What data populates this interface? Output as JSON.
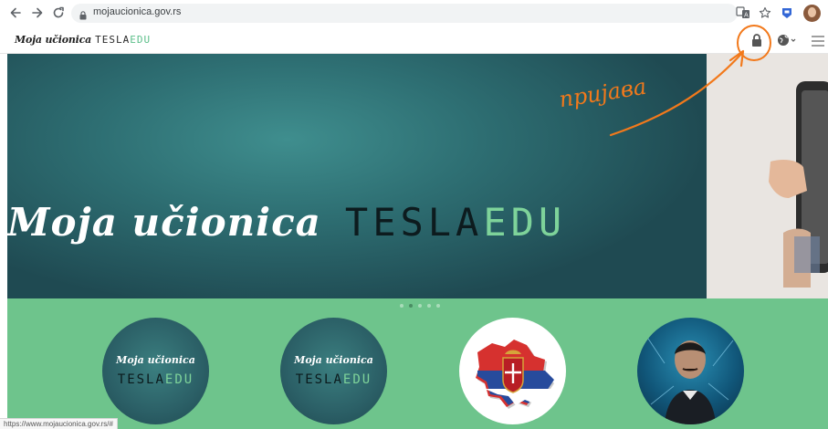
{
  "browser": {
    "url": "mojaucionica.gov.rs",
    "status_url": "https://www.mojaucionica.gov.rs/#"
  },
  "site": {
    "logo_moja": "Moja učionica",
    "logo_tesla": "ТESLA",
    "logo_edu": "EDU"
  },
  "hero": {
    "title_moja": "Moja učionica",
    "title_tesla": "ТESLA",
    "title_edu": "EDU"
  },
  "annotation": {
    "text": "пријава",
    "color": "#f2791b"
  },
  "cards": [
    {
      "moja": "Moja učionica",
      "tesla": "ТESLA",
      "edu": "EDU"
    },
    {
      "moja": "Moja učionica",
      "tesla": "ТESLA",
      "edu": "EDU"
    }
  ],
  "colors": {
    "hero_teal": "#2e6f73",
    "brand_green": "#6ec48c",
    "edu_green": "#7ed39a"
  },
  "icons": {
    "header": [
      "lock-icon",
      "globe-icon",
      "hamburger-menu-icon"
    ],
    "browser": [
      "back-icon",
      "forward-icon",
      "reload-icon",
      "secure-lock-icon",
      "translate-icon",
      "star-icon",
      "extension-icon",
      "profile-avatar"
    ]
  }
}
